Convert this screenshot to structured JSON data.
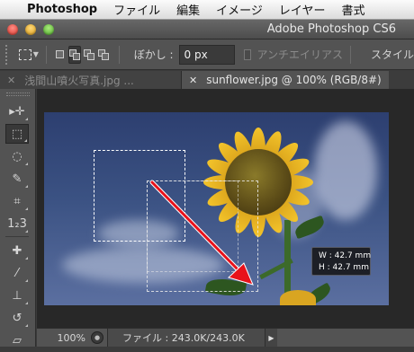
{
  "menubar": {
    "apple_icon": "",
    "app_name": "Photoshop",
    "items": [
      "ファイル",
      "編集",
      "イメージ",
      "レイヤー",
      "書式"
    ]
  },
  "window": {
    "title": "Adobe Photoshop CS6"
  },
  "options": {
    "feather_label": "ぼかし :",
    "feather_value": "0 px",
    "antialias_label": "アンチエイリアス",
    "style_label": "スタイル"
  },
  "tabs": [
    {
      "label": "浅間山噴火写真.jpg ...",
      "active": false
    },
    {
      "label": "sunflower.jpg @ 100% (RGB/8#)",
      "active": true
    }
  ],
  "tools": [
    {
      "name": "move",
      "glyph": "▸✛"
    },
    {
      "name": "rect-marquee",
      "glyph": "⬚"
    },
    {
      "name": "lasso",
      "glyph": "◌"
    },
    {
      "name": "quick-select",
      "glyph": "✎"
    },
    {
      "name": "crop",
      "glyph": "⌗"
    },
    {
      "name": "count",
      "glyph": "1₂3"
    },
    {
      "name": "healing",
      "glyph": "✚"
    },
    {
      "name": "brush",
      "glyph": "⁄"
    },
    {
      "name": "stamp",
      "glyph": "⊥"
    },
    {
      "name": "history-brush",
      "glyph": "↺"
    },
    {
      "name": "eraser",
      "glyph": "▱"
    }
  ],
  "canvas": {
    "size_tooltip": {
      "w": "W : 42.7 mm",
      "h": "H : 42.7 mm"
    }
  },
  "status": {
    "zoom": "100%",
    "file_info": "ファイル : 243.0K/243.0K"
  },
  "colors": {
    "accent": "#535353",
    "selection": "#ffffff",
    "drag_arrow": "#e8121b"
  }
}
